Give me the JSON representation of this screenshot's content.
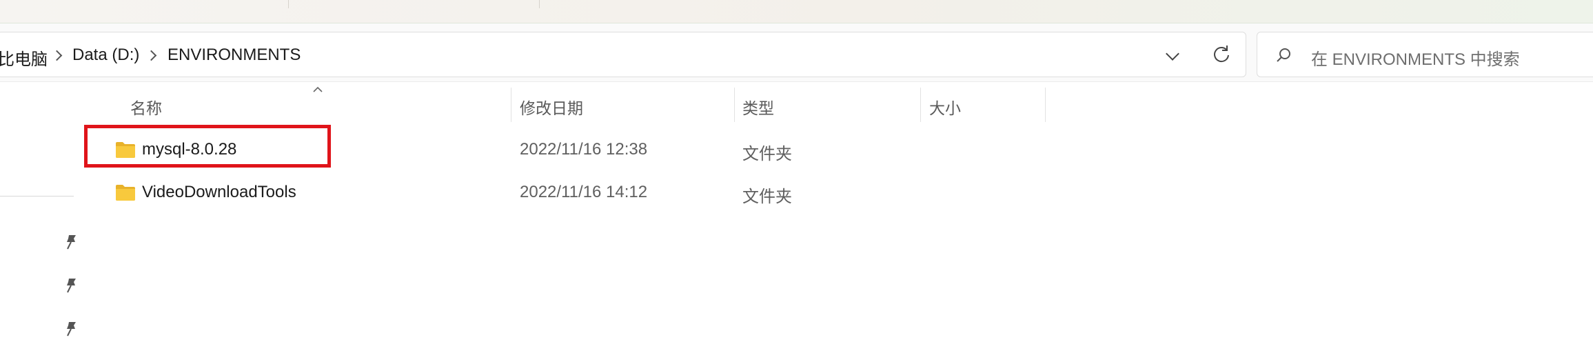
{
  "address": {
    "breadcrumbs": [
      "比电脑",
      "Data (D:)",
      "ENVIRONMENTS"
    ]
  },
  "search": {
    "placeholder": "在 ENVIRONMENTS 中搜索"
  },
  "columns": {
    "name": "名称",
    "modified": "修改日期",
    "type": "类型",
    "size": "大小"
  },
  "files": [
    {
      "name": "mysql-8.0.28",
      "modified": "2022/11/16 12:38",
      "type": "文件夹",
      "size": ""
    },
    {
      "name": "VideoDownloadTools",
      "modified": "2022/11/16 14:12",
      "type": "文件夹",
      "size": ""
    }
  ],
  "colors": {
    "highlight": "#e0141a",
    "folder": "#f8c93d"
  },
  "icons": [
    "chevron-right-icon",
    "chevron-down-icon",
    "refresh-icon",
    "search-icon",
    "sort-up-icon",
    "folder-icon",
    "pin-icon"
  ]
}
